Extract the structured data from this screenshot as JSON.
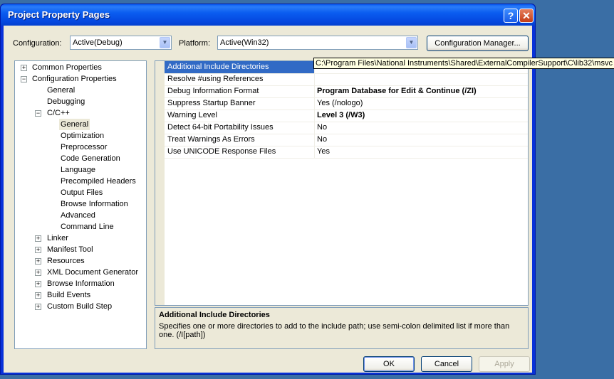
{
  "window": {
    "title": "Project Property Pages"
  },
  "toolbar": {
    "configuration_label": "Configuration:",
    "configuration_value": "Active(Debug)",
    "platform_label": "Platform:",
    "platform_value": "Active(Win32)",
    "config_manager_button": "Configuration Manager..."
  },
  "tree": {
    "common_properties": "Common Properties",
    "configuration_properties": "Configuration Properties",
    "general": "General",
    "debugging": "Debugging",
    "cpp": "C/C++",
    "cpp_children": [
      "General",
      "Optimization",
      "Preprocessor",
      "Code Generation",
      "Language",
      "Precompiled Headers",
      "Output Files",
      "Browse Information",
      "Advanced",
      "Command Line"
    ],
    "other_nodes": [
      "Linker",
      "Manifest Tool",
      "Resources",
      "XML Document Generator",
      "Browse Information",
      "Build Events",
      "Custom Build Step"
    ]
  },
  "properties": [
    {
      "name": "Additional Include Directories",
      "value": "",
      "bold": false
    },
    {
      "name": "Resolve #using References",
      "value": "",
      "bold": false
    },
    {
      "name": "Debug Information Format",
      "value": "Program Database for Edit & Continue (/ZI)",
      "bold": true
    },
    {
      "name": "Suppress Startup Banner",
      "value": "Yes (/nologo)",
      "bold": false
    },
    {
      "name": "Warning Level",
      "value": "Level 3 (/W3)",
      "bold": true
    },
    {
      "name": "Detect 64-bit Portability Issues",
      "value": "No",
      "bold": false
    },
    {
      "name": "Treat Warnings As Errors",
      "value": "No",
      "bold": false
    },
    {
      "name": "Use UNICODE Response Files",
      "value": "Yes",
      "bold": false
    }
  ],
  "tooltip": "C:\\Program Files\\National Instruments\\Shared\\ExternalCompilerSupport\\C\\lib32\\msvc",
  "description": {
    "title": "Additional Include Directories",
    "text": "Specifies one or more directories to add to the include path; use semi-colon delimited list if more than one. (/I[path])"
  },
  "buttons": {
    "ok": "OK",
    "cancel": "Cancel",
    "apply": "Apply"
  }
}
